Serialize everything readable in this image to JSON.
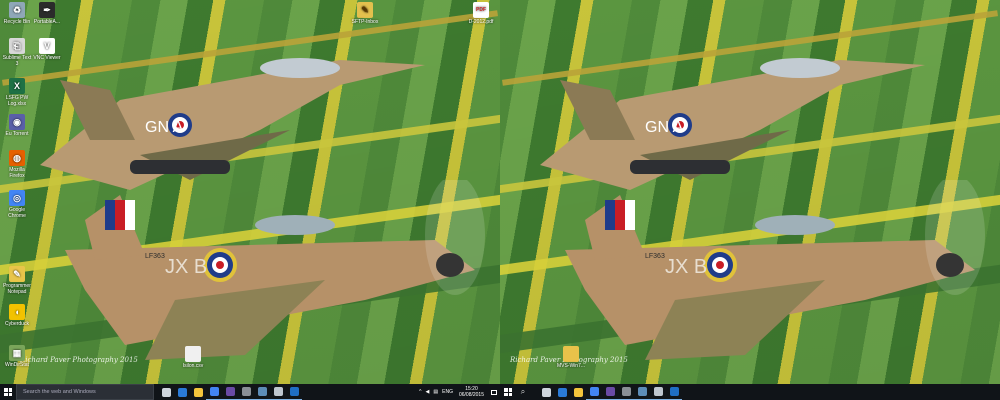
{
  "left_monitor": {
    "desktop_icons": [
      {
        "label": "Recycle Bin",
        "icon": "recycle-bin-icon",
        "color": "#8fa7b8",
        "glyph": "♻"
      },
      {
        "label": "PortableA...",
        "icon": "portable-apps-icon",
        "color": "#2b2b2b",
        "glyph": "✒"
      },
      {
        "label": "Sublime Text 3",
        "icon": "sublime-text-icon",
        "color": "#d8d8d8",
        "glyph": "⎗"
      },
      {
        "label": "VNC Viewer",
        "icon": "vnc-viewer-icon",
        "color": "#ffffff",
        "glyph": "V"
      },
      {
        "label": "LSFG PW Log.xlsx",
        "icon": "excel-file-icon",
        "color": "#1e7145",
        "glyph": "X"
      },
      {
        "label": "Eu Torrent",
        "icon": "torrent-icon",
        "color": "#5a5fa8",
        "glyph": "◉"
      },
      {
        "label": "Mozilla Firefox",
        "icon": "firefox-icon",
        "color": "#e66000",
        "glyph": "◍"
      },
      {
        "label": "Google Chrome",
        "icon": "chrome-icon",
        "color": "#4285f4",
        "glyph": "◎"
      },
      {
        "label": "Programmer Notepad",
        "icon": "notepad-icon",
        "color": "#e8c54a",
        "glyph": "✎"
      },
      {
        "label": "Cyberduck",
        "icon": "cyberduck-icon",
        "color": "#f2c200",
        "glyph": "◖"
      },
      {
        "label": "WinDirStat",
        "icon": "windirstat-icon",
        "color": "#7aa55a",
        "glyph": "▦"
      }
    ],
    "top_icons": [
      {
        "label": "SFTP-Inbox",
        "icon": "ftp-tool-icon",
        "color": "#e3c04d",
        "glyph": "✎"
      },
      {
        "label": "D-2012.pdf",
        "icon": "pdf-file-icon",
        "color": "#d22b2b",
        "glyph": "PDF"
      }
    ],
    "bottom_file": {
      "label": "Isilon.csv",
      "icon": "text-file-icon",
      "color": "#f0f0f0",
      "glyph": ""
    },
    "credit": "Richard Paver Photography 2015",
    "taskbar": {
      "search_placeholder": "Search the web and Windows",
      "apps": [
        {
          "name": "task-view-button",
          "color": "#cfd6dd"
        },
        {
          "name": "edge-button",
          "color": "#2a7bd8"
        },
        {
          "name": "file-explorer-button",
          "color": "#f3c43c"
        },
        {
          "name": "chrome-taskbar-button",
          "color": "#4285f4"
        },
        {
          "name": "media-player-button",
          "color": "#6a4aa5"
        },
        {
          "name": "app-grey-button",
          "color": "#8a8f96"
        },
        {
          "name": "putty-button",
          "color": "#5d8db8"
        },
        {
          "name": "network-tool-button",
          "color": "#bfc7cf"
        },
        {
          "name": "outlook-button",
          "color": "#1f6fc5"
        }
      ],
      "tray_language": "ENG",
      "time": "15:20",
      "date": "06/08/2015"
    }
  },
  "right_monitor": {
    "bottom_file": {
      "label": "MVS-Win7...",
      "icon": "folder-icon",
      "color": "#e8c24a",
      "glyph": ""
    },
    "credit": "Richard Paver Photography 2015",
    "taskbar": {
      "apps": [
        {
          "name": "task-view-button-2",
          "color": "#cfd6dd"
        },
        {
          "name": "edge-button-2",
          "color": "#2a7bd8"
        },
        {
          "name": "file-explorer-button-2",
          "color": "#f3c43c"
        },
        {
          "name": "chrome-taskbar-button-2",
          "color": "#4285f4"
        },
        {
          "name": "media-player-button-2",
          "color": "#6a4aa5"
        },
        {
          "name": "app-grey-button-2",
          "color": "#8a8f96"
        },
        {
          "name": "putty-button-2",
          "color": "#5d8db8"
        },
        {
          "name": "network-tool-button-2",
          "color": "#bfc7cf"
        },
        {
          "name": "outlook-button-2",
          "color": "#1f6fc5"
        }
      ]
    }
  },
  "wallpaper": {
    "typhoon_code": "GN A",
    "hurricane_code": "JX B",
    "hurricane_serial": "LF363"
  }
}
